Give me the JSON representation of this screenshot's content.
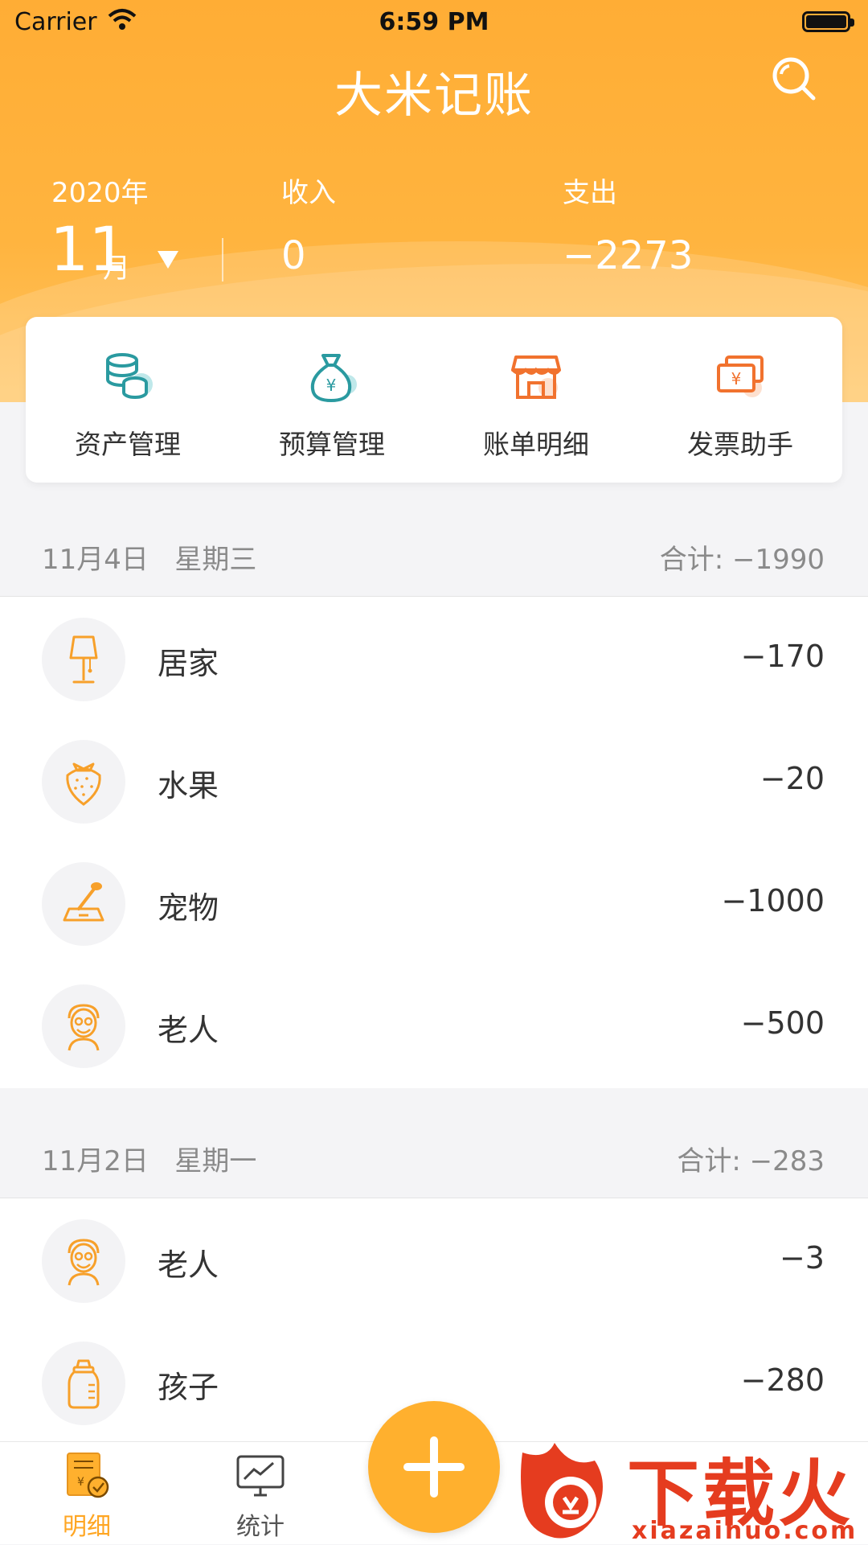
{
  "status_bar": {
    "carrier": "Carrier",
    "time": "6:59 PM"
  },
  "header": {
    "app_title": "大米记账",
    "year": "2020年",
    "month_number": "11",
    "month_suffix": "月",
    "income_label": "收入",
    "income_value": "0",
    "expense_label": "支出",
    "expense_value": "−2273"
  },
  "quick_actions": [
    {
      "label": "资产管理",
      "icon": "coins-stack-icon"
    },
    {
      "label": "预算管理",
      "icon": "money-bag-icon"
    },
    {
      "label": "账单明细",
      "icon": "shop-icon"
    },
    {
      "label": "发票助手",
      "icon": "invoice-icon"
    }
  ],
  "groups": [
    {
      "date": "11月4日",
      "weekday": "星期三",
      "total": "合计: −1990",
      "items": [
        {
          "name": "居家",
          "amount": "−170",
          "icon": "lamp-icon"
        },
        {
          "name": "水果",
          "amount": "−20",
          "icon": "strawberry-icon"
        },
        {
          "name": "宠物",
          "amount": "−1000",
          "icon": "pet-brush-icon"
        },
        {
          "name": "老人",
          "amount": "−500",
          "icon": "elder-icon"
        }
      ]
    },
    {
      "date": "11月2日",
      "weekday": "星期一",
      "total": "合计: −283",
      "items": [
        {
          "name": "老人",
          "amount": "−3",
          "icon": "elder-icon"
        },
        {
          "name": "孩子",
          "amount": "−280",
          "icon": "baby-bottle-icon"
        }
      ]
    }
  ],
  "tabbar": {
    "detail_label": "明细",
    "stats_label": "统计",
    "active_color": "#ffa623"
  },
  "watermark": {
    "brand": "下载火",
    "url": "xiazaihuo.com"
  },
  "colors": {
    "primary": "#ffb02e",
    "icon_orange": "#f7a02a",
    "icon_teal": "#2a9aa0"
  }
}
